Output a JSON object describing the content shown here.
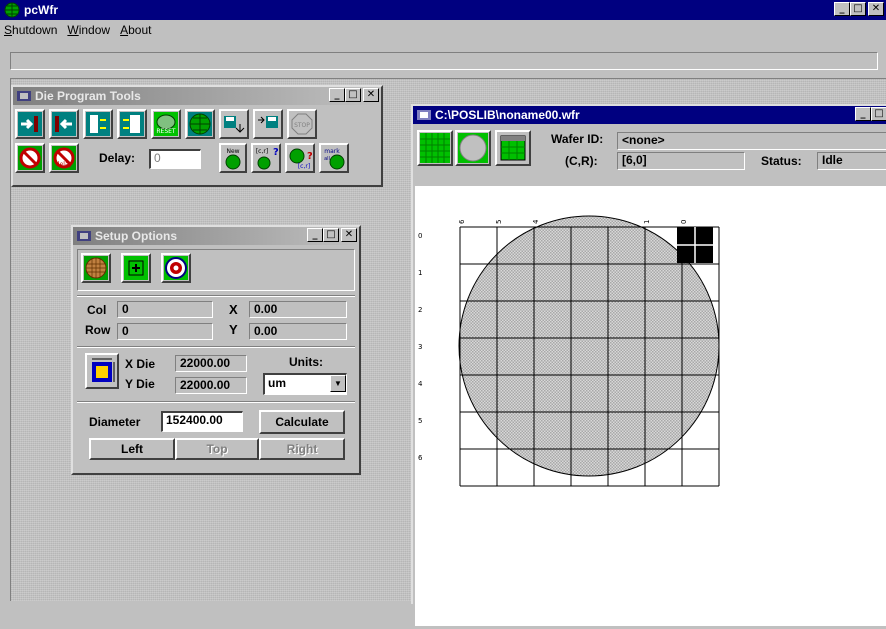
{
  "app": {
    "title": "pcWfr",
    "menu": [
      {
        "label": "Shutdown",
        "underline": "S",
        "rest": "hutdown"
      },
      {
        "label": "Window",
        "underline": "W",
        "rest": "indow"
      },
      {
        "label": "About",
        "underline": "A",
        "rest": "bout"
      }
    ]
  },
  "die_tools": {
    "title": "Die Program Tools",
    "reset_label": "RESET",
    "stop_label": "STOP",
    "delay_label": "Delay:",
    "delay_value": "0",
    "new_label": "New",
    "cr_label": "[c,r]",
    "cr_label2": "[c,r]",
    "mark_label": "mark",
    "all_label": "all",
    "delay_icon_label": "delay"
  },
  "setup": {
    "title": "Setup Options",
    "col_label": "Col",
    "col_value": "0",
    "row_label": "Row",
    "row_value": "0",
    "x_label": "X",
    "x_value": "0.00",
    "y_label": "Y",
    "y_value": "0.00",
    "xdie_label": "X Die",
    "xdie_value": "22000.00",
    "ydie_label": "Y Die",
    "ydie_value": "22000.00",
    "units_label": "Units:",
    "units_value": "um",
    "diameter_label": "Diameter",
    "diameter_value": "152400.00",
    "calculate_label": "Calculate",
    "left_label": "Left",
    "top_label": "Top",
    "right_label": "Right"
  },
  "wafer": {
    "title": "C:\\POSLIB\\noname00.wfr",
    "wafer_id_label": "Wafer ID:",
    "wafer_id_value": "<none>",
    "cr_label": "(C,R):",
    "cr_value": "[6,0]",
    "status_label": "Status:",
    "status_value": "Idle",
    "col_labels": [
      "6",
      "5",
      "4",
      "3",
      "2",
      "1",
      "0"
    ],
    "row_labels": [
      "0",
      "1",
      "2",
      "3",
      "4",
      "5",
      "6"
    ]
  },
  "colors": {
    "titlebar_active": "#000080",
    "titlebar_inactive": "#808080",
    "face": "#c0c0c0",
    "tool_green": "#00c000",
    "tool_teal": "#008080"
  }
}
